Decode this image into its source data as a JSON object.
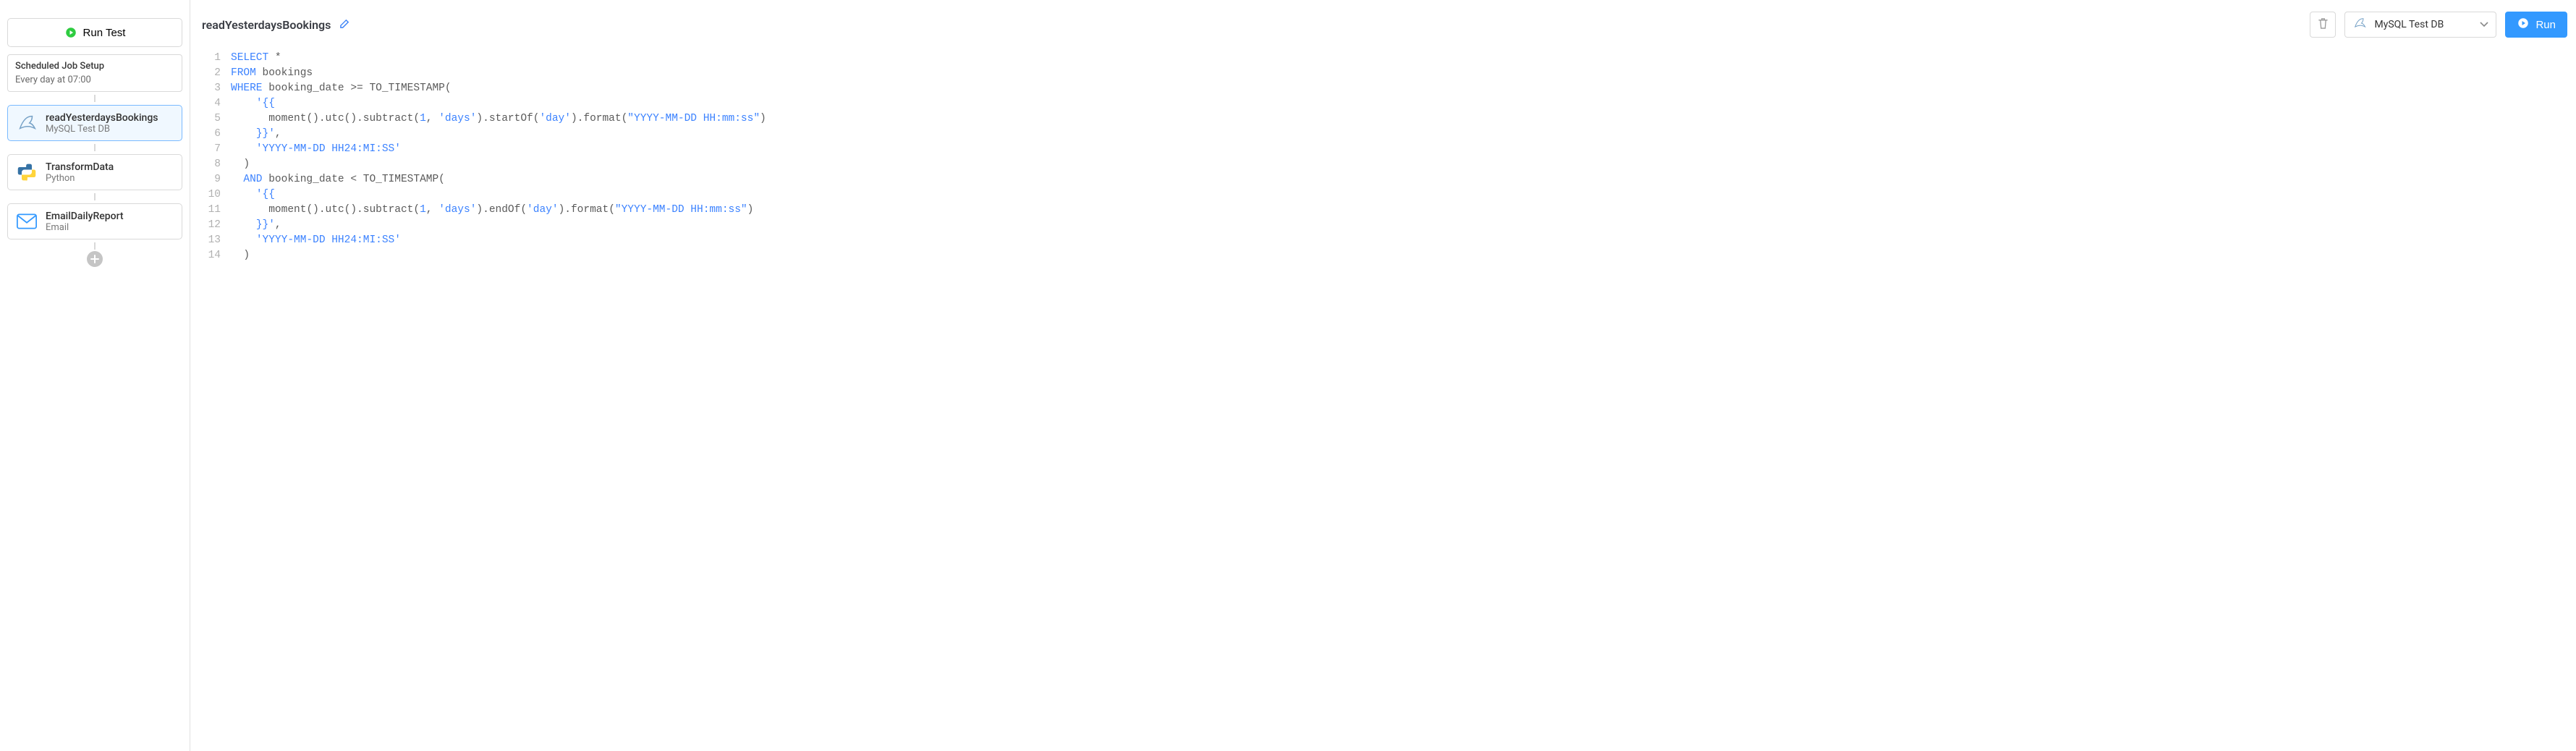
{
  "sidebar": {
    "run_test_label": "Run Test",
    "schedule": {
      "title": "Scheduled Job Setup",
      "sub": "Every day at 07:00"
    },
    "steps": [
      {
        "name": "readYesterdaysBookings",
        "sub": "MySQL Test DB",
        "icon": "mysql",
        "active": true
      },
      {
        "name": "TransformData",
        "sub": "Python",
        "icon": "python",
        "active": false
      },
      {
        "name": "EmailDailyReport",
        "sub": "Email",
        "icon": "email",
        "active": false
      }
    ]
  },
  "header": {
    "query_name": "readYesterdaysBookings",
    "resource_label": "MySQL Test DB",
    "run_label": "Run"
  },
  "code_lines": [
    [
      {
        "c": "kw",
        "t": "SELECT"
      },
      {
        "c": "op",
        "t": " "
      },
      {
        "c": "star",
        "t": "*"
      }
    ],
    [
      {
        "c": "kw",
        "t": "FROM"
      },
      {
        "c": "op",
        "t": " "
      },
      {
        "c": "ident",
        "t": "bookings"
      }
    ],
    [
      {
        "c": "kw",
        "t": "WHERE"
      },
      {
        "c": "op",
        "t": " "
      },
      {
        "c": "ident",
        "t": "booking_date"
      },
      {
        "c": "op",
        "t": " "
      },
      {
        "c": "op",
        "t": ">="
      },
      {
        "c": "op",
        "t": " "
      },
      {
        "c": "ident",
        "t": "TO_TIMESTAMP"
      },
      {
        "c": "op",
        "t": "("
      }
    ],
    [
      {
        "c": "op",
        "t": "    "
      },
      {
        "c": "str",
        "t": "'{{"
      }
    ],
    [
      {
        "c": "op",
        "t": "      "
      },
      {
        "c": "ident",
        "t": "moment"
      },
      {
        "c": "op",
        "t": "()."
      },
      {
        "c": "ident",
        "t": "utc"
      },
      {
        "c": "op",
        "t": "()."
      },
      {
        "c": "ident",
        "t": "subtract"
      },
      {
        "c": "op",
        "t": "("
      },
      {
        "c": "num",
        "t": "1"
      },
      {
        "c": "op",
        "t": ", "
      },
      {
        "c": "str",
        "t": "'days'"
      },
      {
        "c": "op",
        "t": ")."
      },
      {
        "c": "ident",
        "t": "startOf"
      },
      {
        "c": "op",
        "t": "("
      },
      {
        "c": "str",
        "t": "'day'"
      },
      {
        "c": "op",
        "t": ")."
      },
      {
        "c": "ident",
        "t": "format"
      },
      {
        "c": "op",
        "t": "("
      },
      {
        "c": "str",
        "t": "\"YYYY-MM-DD HH:mm:ss\""
      },
      {
        "c": "op",
        "t": ")"
      }
    ],
    [
      {
        "c": "op",
        "t": "    "
      },
      {
        "c": "str",
        "t": "}}'"
      },
      {
        "c": "op",
        "t": ","
      }
    ],
    [
      {
        "c": "op",
        "t": "    "
      },
      {
        "c": "str",
        "t": "'YYYY-MM-DD HH24:MI:SS'"
      }
    ],
    [
      {
        "c": "op",
        "t": "  "
      },
      {
        "c": "op",
        "t": ")"
      }
    ],
    [
      {
        "c": "op",
        "t": "  "
      },
      {
        "c": "kw",
        "t": "AND"
      },
      {
        "c": "op",
        "t": " "
      },
      {
        "c": "ident",
        "t": "booking_date"
      },
      {
        "c": "op",
        "t": " "
      },
      {
        "c": "op",
        "t": "<"
      },
      {
        "c": "op",
        "t": " "
      },
      {
        "c": "ident",
        "t": "TO_TIMESTAMP"
      },
      {
        "c": "op",
        "t": "("
      }
    ],
    [
      {
        "c": "op",
        "t": "    "
      },
      {
        "c": "str",
        "t": "'{{"
      }
    ],
    [
      {
        "c": "op",
        "t": "      "
      },
      {
        "c": "ident",
        "t": "moment"
      },
      {
        "c": "op",
        "t": "()."
      },
      {
        "c": "ident",
        "t": "utc"
      },
      {
        "c": "op",
        "t": "()."
      },
      {
        "c": "ident",
        "t": "subtract"
      },
      {
        "c": "op",
        "t": "("
      },
      {
        "c": "num",
        "t": "1"
      },
      {
        "c": "op",
        "t": ", "
      },
      {
        "c": "str",
        "t": "'days'"
      },
      {
        "c": "op",
        "t": ")."
      },
      {
        "c": "ident",
        "t": "endOf"
      },
      {
        "c": "op",
        "t": "("
      },
      {
        "c": "str",
        "t": "'day'"
      },
      {
        "c": "op",
        "t": ")."
      },
      {
        "c": "ident",
        "t": "format"
      },
      {
        "c": "op",
        "t": "("
      },
      {
        "c": "str",
        "t": "\"YYYY-MM-DD HH:mm:ss\""
      },
      {
        "c": "op",
        "t": ")"
      }
    ],
    [
      {
        "c": "op",
        "t": "    "
      },
      {
        "c": "str",
        "t": "}}'"
      },
      {
        "c": "op",
        "t": ","
      }
    ],
    [
      {
        "c": "op",
        "t": "    "
      },
      {
        "c": "str",
        "t": "'YYYY-MM-DD HH24:MI:SS'"
      }
    ],
    [
      {
        "c": "op",
        "t": "  "
      },
      {
        "c": "op",
        "t": ")"
      }
    ]
  ]
}
